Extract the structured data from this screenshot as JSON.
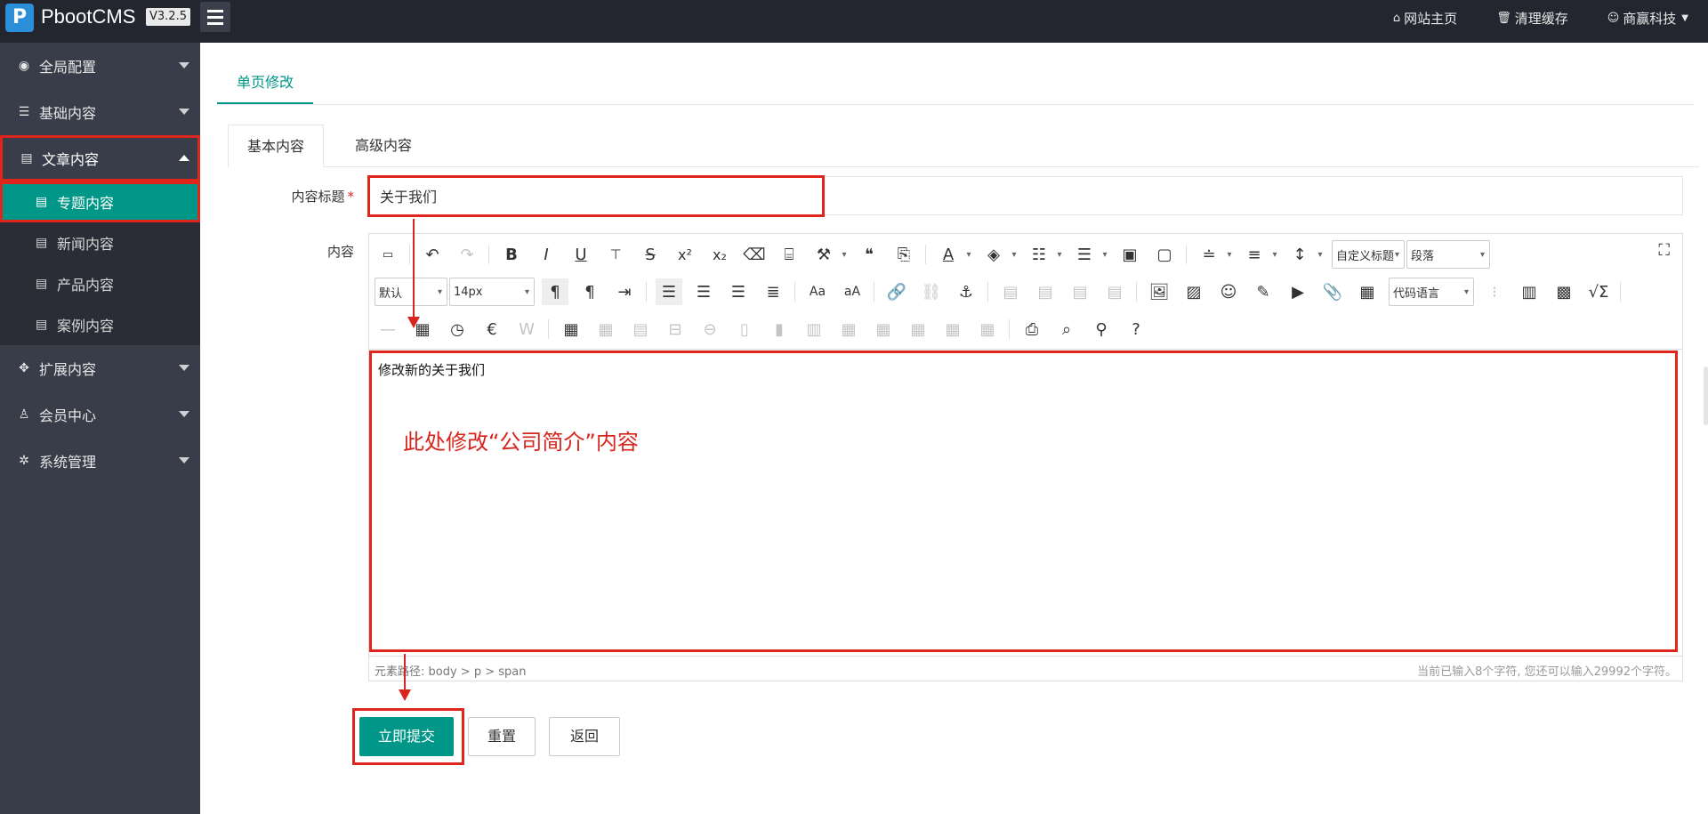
{
  "topbar": {
    "logo_letter": "P",
    "brand": "PbootCMS",
    "version": "V3.2.5",
    "links": [
      {
        "icon": "home-icon",
        "glyph": "⌂",
        "label": "网站主页"
      },
      {
        "icon": "trash-icon",
        "glyph": "🗑",
        "label": "清理缓存"
      },
      {
        "icon": "user-icon",
        "glyph": "☺",
        "label": "商赢科技"
      }
    ]
  },
  "sidebar": {
    "items": [
      {
        "label": "全局配置",
        "icon": "globe-icon",
        "glyph": "◉"
      },
      {
        "label": "基础内容",
        "icon": "sliders-icon",
        "glyph": "☰"
      },
      {
        "label": "文章内容",
        "icon": "file-icon",
        "glyph": "▤"
      },
      {
        "label": "扩展内容",
        "icon": "expand-icon",
        "glyph": "✥"
      },
      {
        "label": "会员中心",
        "icon": "user-icon",
        "glyph": "♙"
      },
      {
        "label": "系统管理",
        "icon": "gear-icon",
        "glyph": "✲"
      }
    ],
    "sub_items": [
      "专题内容",
      "新闻内容",
      "产品内容",
      "案例内容"
    ]
  },
  "main": {
    "page_tab": "单页修改",
    "tabs": [
      "基本内容",
      "高级内容"
    ],
    "title_label": "内容标题",
    "required_mark": "*",
    "title_value": "关于我们",
    "content_label": "内容"
  },
  "editor": {
    "font_family": "默认",
    "font_size": "14px",
    "custom_title": "自定义标题",
    "paragraph": "段落",
    "code_lang": "代码语言",
    "content_text": "修改新的关于我们",
    "annotation": "此处修改“公司简介”内容",
    "element_path": "元素路径: body > p > span",
    "char_count": "当前已输入8个字符, 您还可以输入29992个字符。"
  },
  "buttons": {
    "submit": "立即提交",
    "reset": "重置",
    "back": "返回"
  },
  "colors": {
    "accent": "#009688",
    "sidebar": "#393d49",
    "topbar": "#23262e",
    "annotation": "#d8251d"
  }
}
